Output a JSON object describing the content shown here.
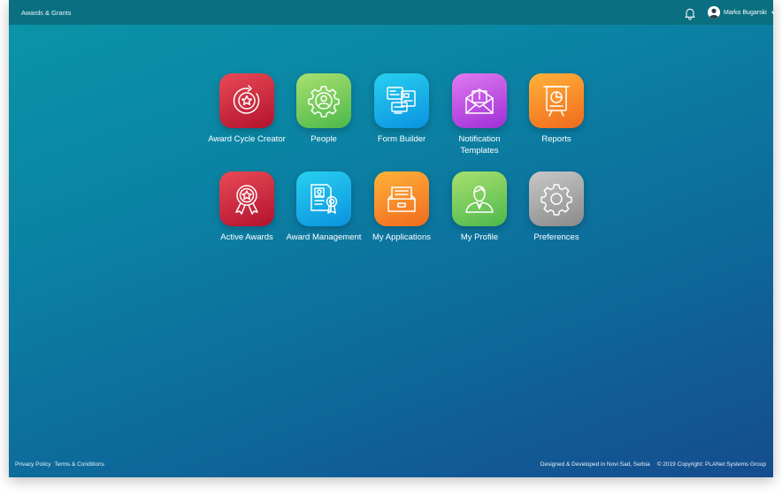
{
  "header": {
    "app_title": "Awards & Grants",
    "user_name": "Marko Bugarski",
    "bell_icon": "bell-icon",
    "avatar_icon": "user-avatar-icon"
  },
  "tiles": [
    {
      "label": "Award Cycle Creator",
      "icon": "award-cycle-icon",
      "color": "#d1283c"
    },
    {
      "label": "People",
      "icon": "people-gear-icon",
      "color": "#7ccc5a"
    },
    {
      "label": "Form Builder",
      "icon": "form-builder-icon",
      "color": "#14b2ea"
    },
    {
      "label": "Notification Templates",
      "icon": "notification-envelope-icon",
      "color": "#c255e6"
    },
    {
      "label": "Reports",
      "icon": "reports-chart-icon",
      "color": "#f88e2a"
    },
    {
      "label": "Active Awards",
      "icon": "award-medal-icon",
      "color": "#d1283c"
    },
    {
      "label": "Award Management",
      "icon": "award-certificate-icon",
      "color": "#14b2ea"
    },
    {
      "label": "My Applications",
      "icon": "applications-drawer-icon",
      "color": "#f88e2a"
    },
    {
      "label": "My Profile",
      "icon": "profile-user-icon",
      "color": "#7ccc5a"
    },
    {
      "label": "Preferences",
      "icon": "settings-gear-icon",
      "color": "#a8a8a8"
    }
  ],
  "footer": {
    "privacy": "Privacy Policy",
    "terms": "Terms & Conditions",
    "designed": "Designed & Developed in Novi Sad, Serbia",
    "copyright": "© 2019 Copyright: PLANet Systems Group"
  }
}
